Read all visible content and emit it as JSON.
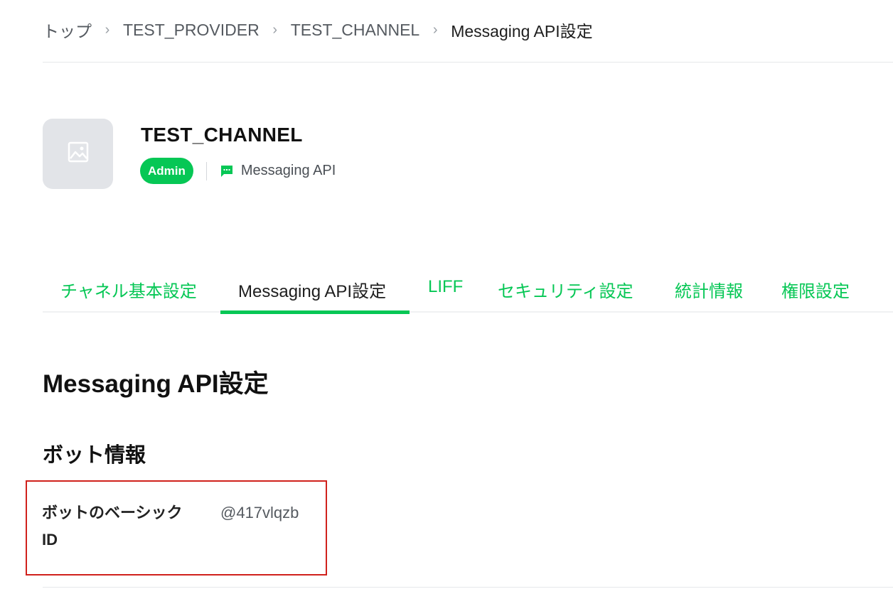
{
  "breadcrumb": {
    "items": [
      "トップ",
      "TEST_PROVIDER",
      "TEST_CHANNEL"
    ],
    "current": "Messaging API設定"
  },
  "channel": {
    "name": "TEST_CHANNEL",
    "role": "Admin",
    "type": "Messaging API",
    "thumbnail_icon": "image-placeholder-icon"
  },
  "tabs": [
    {
      "label": "チャネル基本設定",
      "active": false
    },
    {
      "label": "Messaging API設定",
      "active": true
    },
    {
      "label": "LIFF",
      "active": false
    },
    {
      "label": "セキュリティ設定",
      "active": false
    },
    {
      "label": "統計情報",
      "active": false
    },
    {
      "label": "権限設定",
      "active": false
    }
  ],
  "page": {
    "title": "Messaging API設定"
  },
  "bot_info": {
    "section_title": "ボット情報",
    "basic_id_label_line1": "ボットのベーシック",
    "basic_id_label_line2": "ID",
    "basic_id_value": "@417vlqzb"
  },
  "colors": {
    "accent": "#06c755",
    "highlight": "#d0211c"
  }
}
